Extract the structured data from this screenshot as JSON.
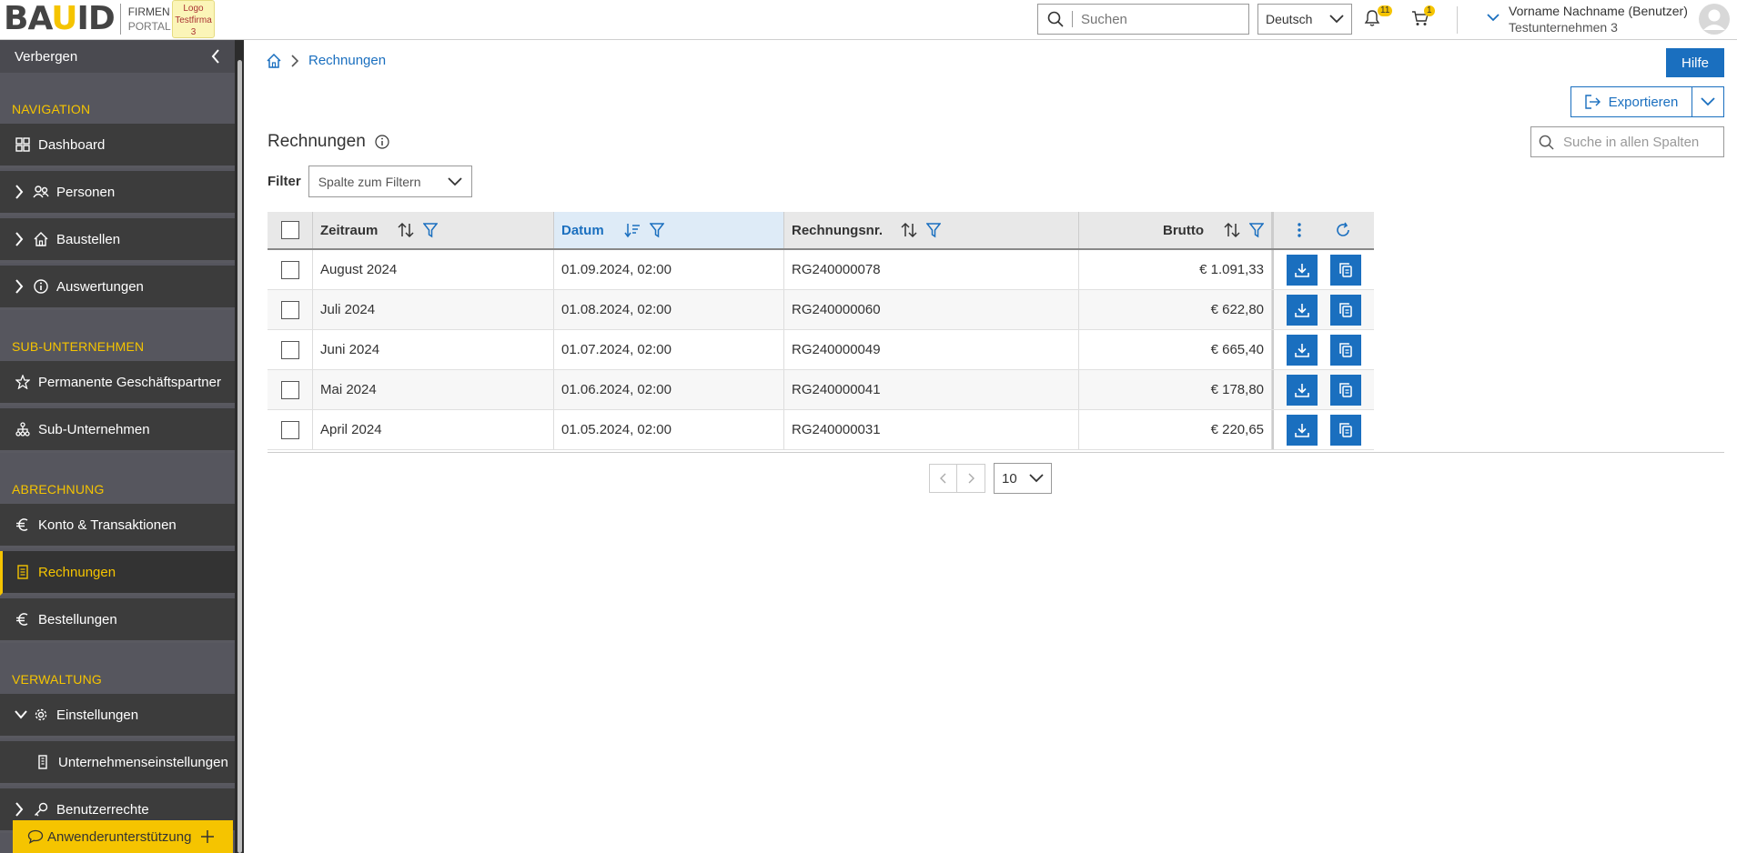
{
  "header": {
    "logo_text": "BAUID",
    "logo_sub1": "FIRMEN",
    "logo_sub2": "PORTAL",
    "company_logo_text": "Logo Testfirma 3",
    "search_placeholder": "Suchen",
    "language": "Deutsch",
    "notifications_count": "11",
    "cart_count": "1",
    "user_name": "Vorname Nachname (Benutzer)",
    "user_company": "Testunternehmen 3"
  },
  "sidebar": {
    "hide_label": "Verbergen",
    "section_navigation": "NAVIGATION",
    "dashboard": "Dashboard",
    "personen": "Personen",
    "baustellen": "Baustellen",
    "auswertungen": "Auswertungen",
    "section_sub": "SUB-UNTERNEHMEN",
    "permanente": "Permanente Geschäftspartner",
    "sub_unternehmen": "Sub-Unternehmen",
    "section_abrechnung": "ABRECHNUNG",
    "konto": "Konto & Transaktionen",
    "rechnungen": "Rechnungen",
    "bestellungen": "Bestellungen",
    "section_verwaltung": "VERWALTUNG",
    "einstellungen": "Einstellungen",
    "unternehmenseinstellungen": "Unternehmenseinstellungen",
    "benutzerrechte": "Benutzerrechte",
    "support": "Anwenderunterstützung"
  },
  "main": {
    "breadcrumb_current": "Rechnungen",
    "help_label": "Hilfe",
    "export_label": "Exportieren",
    "title": "Rechnungen",
    "column_search_placeholder": "Suche in allen Spalten",
    "filter_label": "Filter",
    "filter_select": "Spalte zum Filtern",
    "page_size": "10"
  },
  "table": {
    "headers": {
      "zeitraum": "Zeitraum",
      "datum": "Datum",
      "rechnungsnr": "Rechnungsnr.",
      "brutto": "Brutto"
    },
    "rows": [
      {
        "zeitraum": "August 2024",
        "datum": "01.09.2024, 02:00",
        "nr": "RG240000078",
        "brutto": "€ 1.091,33"
      },
      {
        "zeitraum": "Juli 2024",
        "datum": "01.08.2024, 02:00",
        "nr": "RG240000060",
        "brutto": "€ 622,80"
      },
      {
        "zeitraum": "Juni 2024",
        "datum": "01.07.2024, 02:00",
        "nr": "RG240000049",
        "brutto": "€ 665,40"
      },
      {
        "zeitraum": "Mai 2024",
        "datum": "01.06.2024, 02:00",
        "nr": "RG240000041",
        "brutto": "€ 178,80"
      },
      {
        "zeitraum": "April 2024",
        "datum": "01.05.2024, 02:00",
        "nr": "RG240000031",
        "brutto": "€ 220,65"
      }
    ]
  },
  "colors": {
    "accent": "#1a6fbf",
    "brand_yellow": "#f5c400",
    "sidebar_bg": "#56565e"
  }
}
